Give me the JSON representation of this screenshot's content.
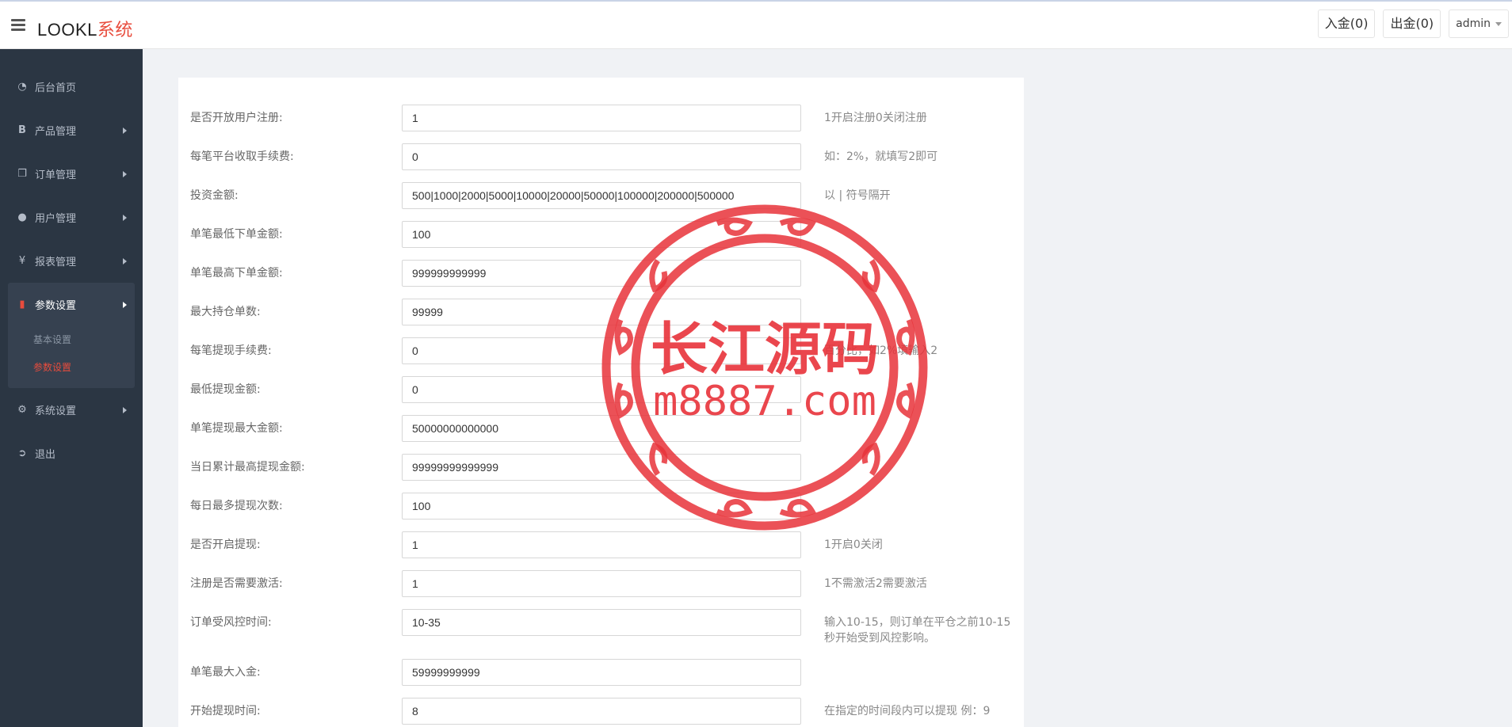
{
  "topbar": {
    "logo_main": "LOOKL",
    "logo_accent": "系统",
    "deposit_label": "入金(0)",
    "withdraw_label": "出金(0)",
    "user_label": "admin"
  },
  "sidebar": {
    "items": [
      {
        "label": "后台首页",
        "icon": "dashboard-icon"
      },
      {
        "label": "产品管理",
        "icon": "bitcoin-icon"
      },
      {
        "label": "订单管理",
        "icon": "copy-icon"
      },
      {
        "label": "用户管理",
        "icon": "user-icon"
      },
      {
        "label": "报表管理",
        "icon": "yen-icon"
      },
      {
        "label": "参数设置",
        "icon": "files-icon",
        "active": true
      },
      {
        "label": "系统设置",
        "icon": "gears-icon"
      },
      {
        "label": "退出",
        "icon": "sign-out-icon"
      }
    ],
    "sub_items": [
      {
        "label": "基本设置"
      },
      {
        "label": "参数设置",
        "current": true
      }
    ]
  },
  "form": {
    "rows": [
      {
        "label": "是否开放用户注册:",
        "value": "1",
        "hint": "1开启注册0关闭注册"
      },
      {
        "label": "每笔平台收取手续费:",
        "value": "0",
        "hint": "如：2%，就填写2即可"
      },
      {
        "label": "投资金额:",
        "value": "500|1000|2000|5000|10000|20000|50000|100000|200000|500000",
        "hint": "以 | 符号隔开"
      },
      {
        "label": "单笔最低下单金额:",
        "value": "100",
        "hint": ""
      },
      {
        "label": "单笔最高下单金额:",
        "value": "999999999999",
        "hint": ""
      },
      {
        "label": "最大持仓单数:",
        "value": "99999",
        "hint": ""
      },
      {
        "label": "每笔提现手续费:",
        "value": "0",
        "hint": "百分比，如2%填输入2"
      },
      {
        "label": "最低提现金额:",
        "value": "0",
        "hint": ""
      },
      {
        "label": "单笔提现最大金额:",
        "value": "50000000000000",
        "hint": ""
      },
      {
        "label": "当日累计最高提现金额:",
        "value": "99999999999999",
        "hint": ""
      },
      {
        "label": "每日最多提现次数:",
        "value": "100",
        "hint": ""
      },
      {
        "label": "是否开启提现:",
        "value": "1",
        "hint": "1开启0关闭"
      },
      {
        "label": "注册是否需要激活:",
        "value": "1",
        "hint": "1不需激活2需要激活"
      },
      {
        "label": "订单受风控时间:",
        "value": "10-35",
        "hint": "输入10-15，则订单在平仓之前10-15秒开始受到风控影响。"
      },
      {
        "label": "单笔最大入金:",
        "value": "59999999999",
        "hint": ""
      },
      {
        "label": "开始提现时间:",
        "value": "8",
        "hint": "在指定的时间段内可以提现 例：9"
      }
    ]
  },
  "watermark": {
    "title": "长江源码",
    "url": "m8887.com",
    "color": "#e8333a"
  }
}
